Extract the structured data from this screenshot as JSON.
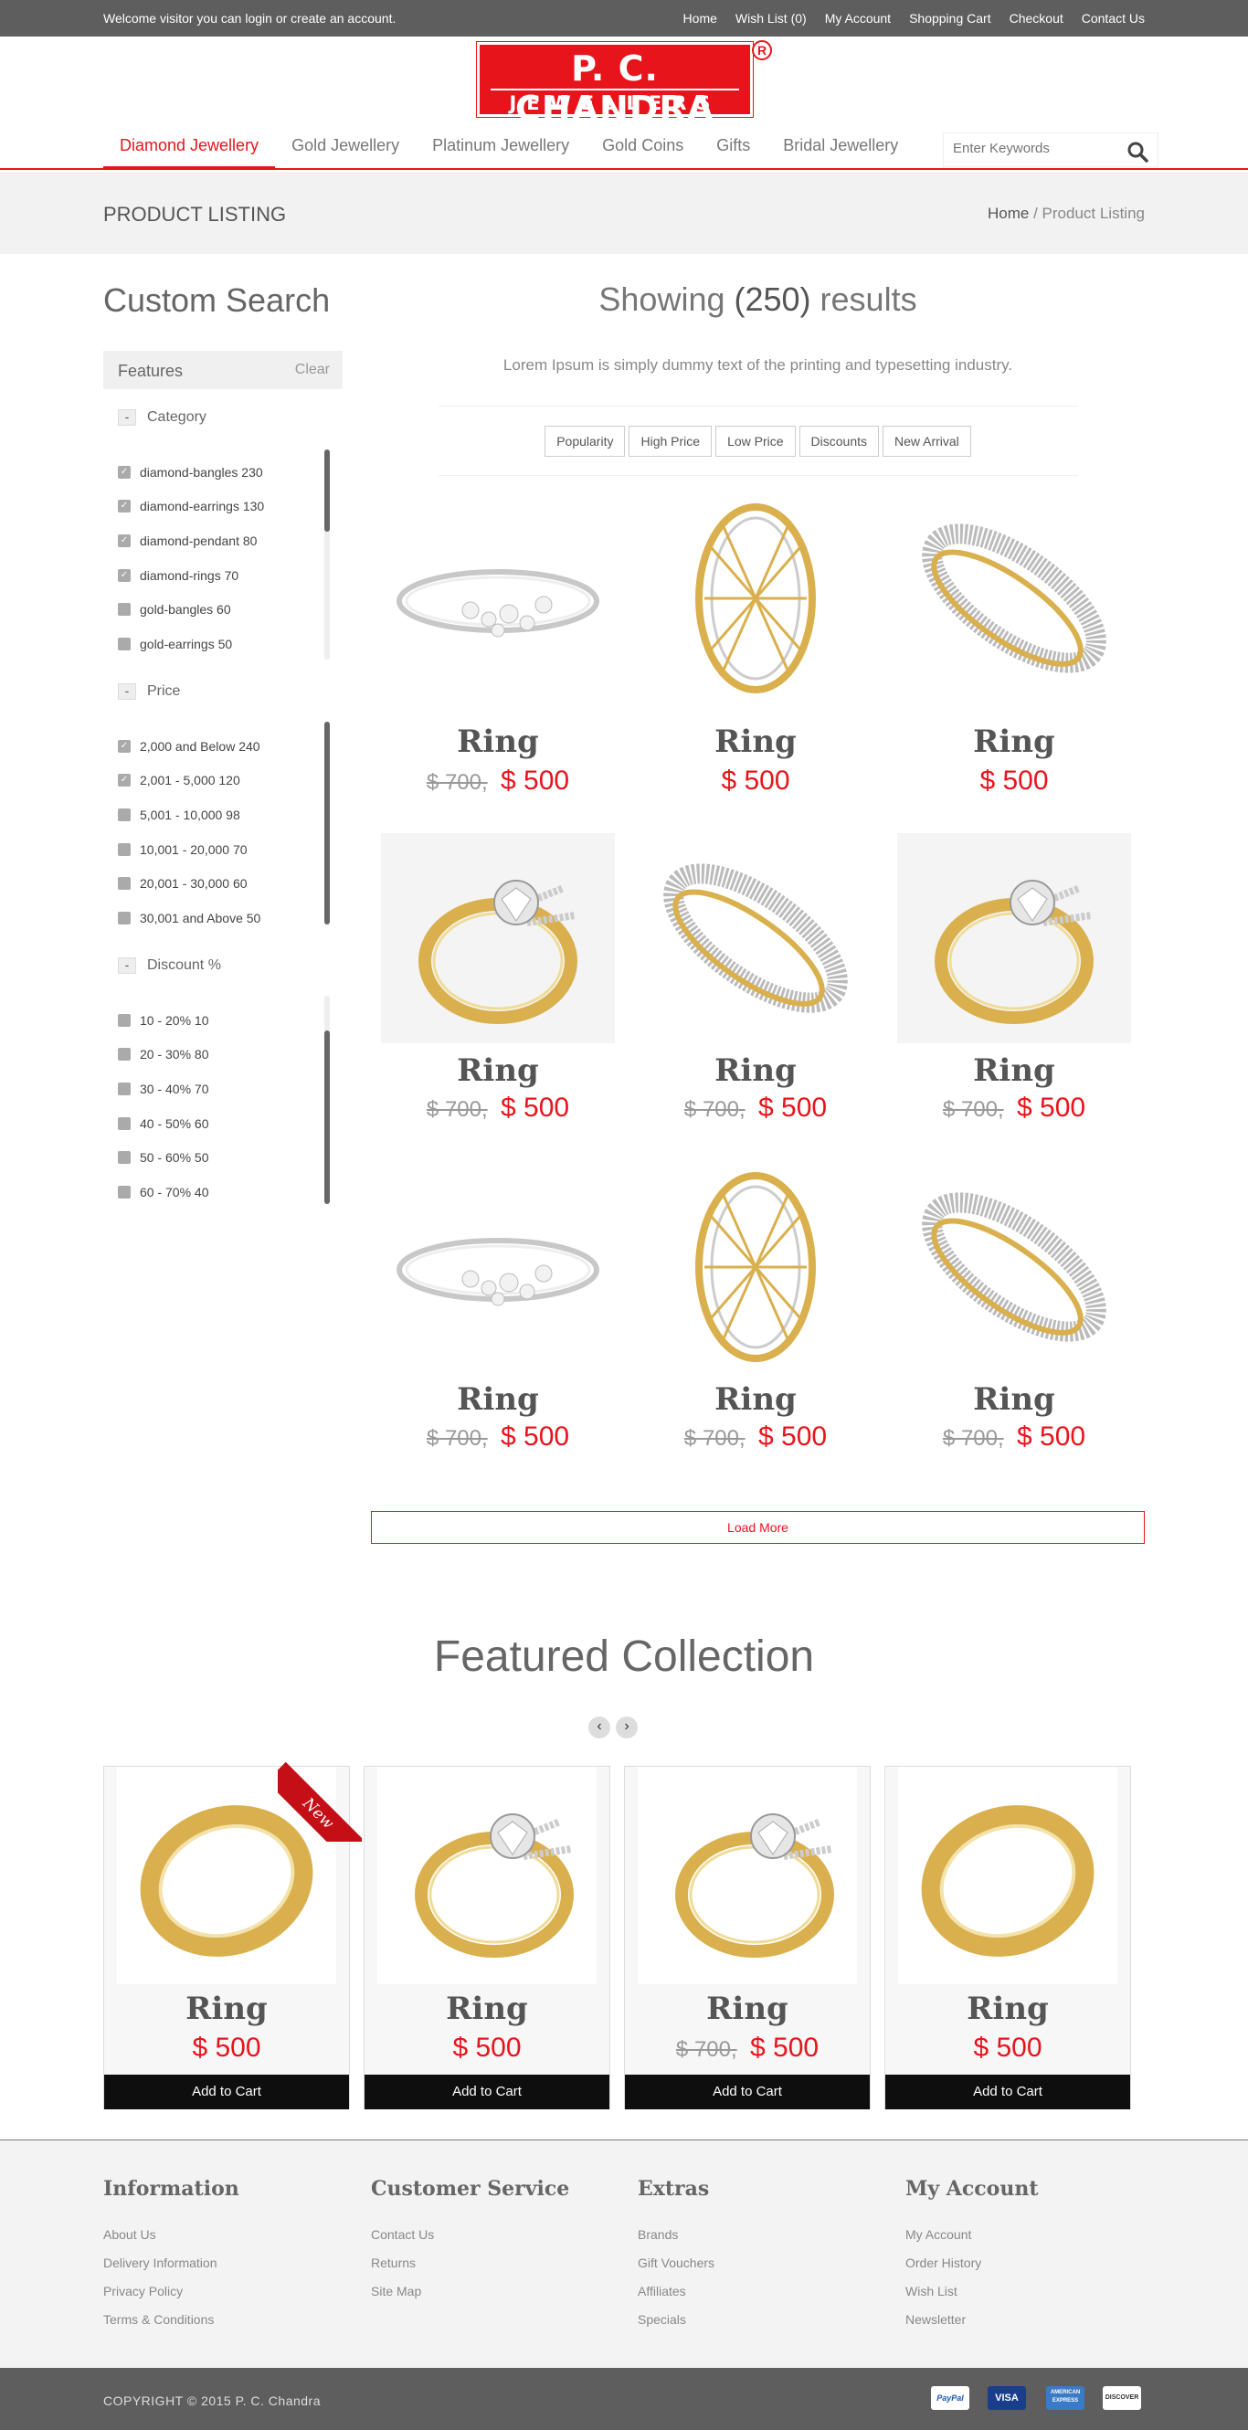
{
  "topbar": {
    "welcome": "Welcome visitor you can login or create an account.",
    "links": [
      "Home",
      "Wish List (0)",
      "My Account",
      "Shopping Cart",
      "Checkout",
      "Contact Us"
    ]
  },
  "logo": {
    "line1": "P. C. CHANDRA",
    "line2": "JEWELLERS",
    "reg": "R"
  },
  "nav": {
    "items": [
      "Diamond Jewellery",
      "Gold Jewellery",
      "Platinum Jewellery",
      "Gold Coins",
      "Gifts",
      "Bridal Jewellery"
    ],
    "active": "Diamond Jewellery",
    "search_placeholder": "Enter Keywords"
  },
  "page": {
    "title": "PRODUCT LISTING",
    "breadcrumb_home": "Home",
    "breadcrumb_sep": " / ",
    "breadcrumb_current": "Product Listing"
  },
  "sidebar": {
    "title": "Custom Search",
    "features_label": "Features",
    "clear_label": "Clear",
    "groups": [
      {
        "title": "Category",
        "options": [
          {
            "label": "diamond-bangles 230",
            "checked": true
          },
          {
            "label": "diamond-earrings 130",
            "checked": true
          },
          {
            "label": "diamond-pendant 80",
            "checked": true
          },
          {
            "label": "diamond-rings 70",
            "checked": true
          },
          {
            "label": "gold-bangles 60",
            "checked": false
          },
          {
            "label": "gold-earrings 50",
            "checked": false
          }
        ]
      },
      {
        "title": "Price",
        "options": [
          {
            "label": "2,000 and Below 240",
            "checked": true
          },
          {
            "label": "2,001 - 5,000 120",
            "checked": true
          },
          {
            "label": "5,001 - 10,000 98",
            "checked": false
          },
          {
            "label": "10,001 - 20,000 70",
            "checked": false
          },
          {
            "label": "20,001 - 30,000 60",
            "checked": false
          },
          {
            "label": "30,001 and Above 50",
            "checked": false
          }
        ]
      },
      {
        "title": "Discount %",
        "options": [
          {
            "label": "10 - 20% 10",
            "checked": false
          },
          {
            "label": "20 - 30% 80",
            "checked": false
          },
          {
            "label": "30 - 40% 70",
            "checked": false
          },
          {
            "label": "40 - 50% 60",
            "checked": false
          },
          {
            "label": "50 - 60% 50",
            "checked": false
          },
          {
            "label": "60 - 70% 40",
            "checked": false
          }
        ]
      }
    ]
  },
  "results": {
    "showing_prefix": "Showing ",
    "count": "(250)",
    "showing_suffix": " results",
    "description": "Lorem Ipsum is simply dummy text of the printing and typesetting industry.",
    "sort_buttons": [
      "Popularity",
      "High Price",
      "Low Price",
      "Discounts",
      "New Arrival"
    ],
    "load_more": "Load More"
  },
  "products": [
    {
      "name": "Ring",
      "old_price": "$ 700,",
      "price": "$ 500",
      "image": "bracelet-pearl"
    },
    {
      "name": "Ring",
      "old_price": "",
      "price": "$ 500",
      "image": "bangle-lattice"
    },
    {
      "name": "Ring",
      "old_price": "",
      "price": "$ 500",
      "image": "bangle-pave"
    },
    {
      "name": "Ring",
      "old_price": "$ 700,",
      "price": "$ 500",
      "image": "ring-solitaire"
    },
    {
      "name": "Ring",
      "old_price": "$ 700,",
      "price": "$ 500",
      "image": "bangle-pave"
    },
    {
      "name": "Ring",
      "old_price": "$ 700,",
      "price": "$ 500",
      "image": "ring-solitaire"
    },
    {
      "name": "Ring",
      "old_price": "$ 700,",
      "price": "$ 500",
      "image": "bracelet-pearl"
    },
    {
      "name": "Ring",
      "old_price": "$ 700,",
      "price": "$ 500",
      "image": "bangle-lattice"
    },
    {
      "name": "Ring",
      "old_price": "$ 700,",
      "price": "$ 500",
      "image": "bangle-pave"
    }
  ],
  "featured": {
    "title": "Featured Collection",
    "prev": "‹",
    "next": "›",
    "ribbon": "New",
    "cart_label": "Add to Cart",
    "items": [
      {
        "name": "Ring",
        "old_price": "",
        "price": "$ 500",
        "image": "band-gold"
      },
      {
        "name": "Ring",
        "old_price": "",
        "price": "$ 500",
        "image": "ring-solitaire"
      },
      {
        "name": "Ring",
        "old_price": "$ 700,",
        "price": "$ 500",
        "image": "ring-solitaire"
      },
      {
        "name": "Ring",
        "old_price": "",
        "price": "$ 500",
        "image": "band-gold"
      }
    ]
  },
  "footer": {
    "columns": [
      {
        "title": "Information",
        "links": [
          "About Us",
          "Delivery Information",
          "Privacy Policy",
          "Terms & Conditions"
        ]
      },
      {
        "title": "Customer Service",
        "links": [
          "Contact Us",
          "Returns",
          "Site Map"
        ]
      },
      {
        "title": "Extras",
        "links": [
          "Brands",
          "Gift Vouchers",
          "Affiliates",
          "Specials"
        ]
      },
      {
        "title": "My Account",
        "links": [
          "My Account",
          "Order History",
          "Wish List",
          "Newsletter"
        ]
      }
    ],
    "copyright": "COPYRIGHT © 2015 P. C. Chandra",
    "payments": [
      "PayPal",
      "VISA",
      "AMERICAN EXPRESS",
      "DISCOVER"
    ]
  },
  "colors": {
    "accent": "#e8141c",
    "topbar": "#5e5e5e",
    "gold": "#d9b04d",
    "silver": "#c8c8c8"
  }
}
